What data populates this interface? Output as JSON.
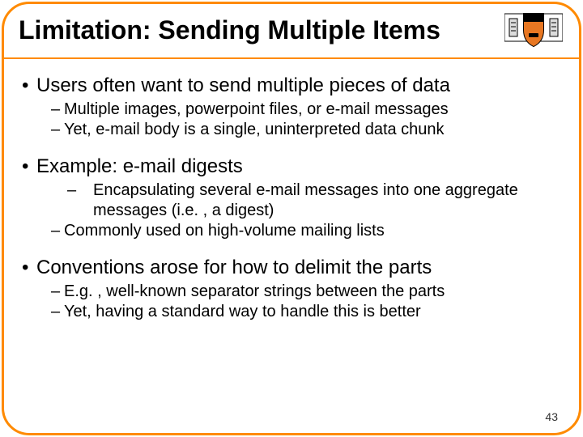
{
  "slide": {
    "title": "Limitation: Sending Multiple Items",
    "page_number": "43",
    "sections": [
      {
        "bullet": "Users often want to send multiple pieces of data",
        "subs": [
          "Multiple images, powerpoint files, or e-mail messages",
          "Yet, e-mail body is a single, uninterpreted data chunk"
        ]
      },
      {
        "bullet": "Example: e-mail digests",
        "subs": [
          "Encapsulating several e-mail messages into one aggregate messages (i.e. , a digest)",
          "Commonly used on high-volume mailing lists"
        ]
      },
      {
        "bullet": "Conventions arose for how to delimit the parts",
        "subs": [
          "E.g. , well-known separator strings between the parts",
          "Yet, having a standard way to handle this is better"
        ]
      }
    ]
  },
  "icon": {
    "name": "princeton-shield-icon"
  }
}
